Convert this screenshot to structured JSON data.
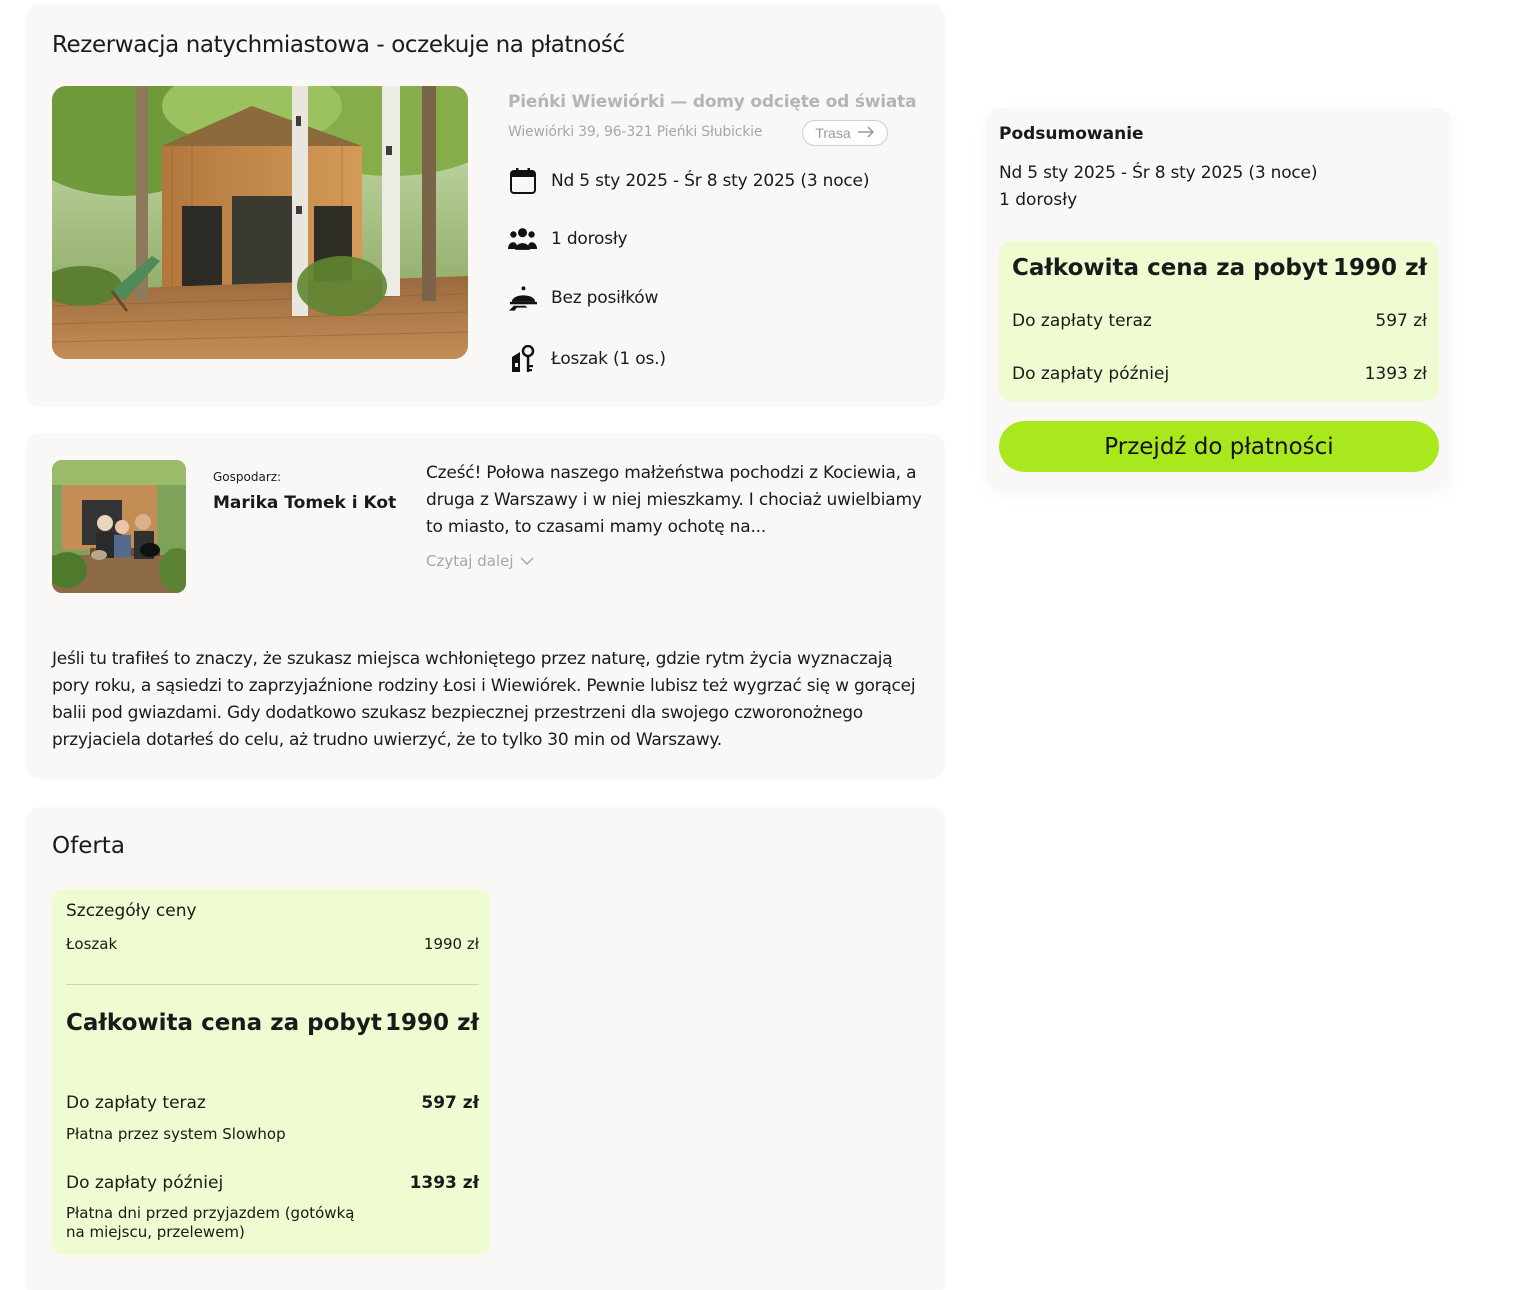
{
  "booking": {
    "title": "Rezerwacja natychmiastowa - oczekuje na płatność",
    "property_name": "Pieńki Wiewiórki — domy odcięte od świata",
    "address": "Wiewiórki 39, 96-321 Pieńki Słubickie",
    "route_label": "Trasa",
    "dates": "Nd 5 sty 2025 - Śr 8 sty 2025 (3 noce)",
    "guests": "1 dorosły",
    "meals": "Bez posiłków",
    "room": "Łoszak  (1 os.)"
  },
  "host": {
    "caption": "Gospodarz:",
    "name": "Marika Tomek i Kot",
    "bio": "Cześć! Połowa naszego małżeństwa pochodzi z Kociewia, a druga z Warszawy i w niej mieszkamy. I chociaż uwielbiamy to miasto, to czasami mamy ochotę na...",
    "read_more": "Czytaj dalej",
    "description": "Jeśli tu trafiłeś to znaczy, że szukasz miejsca wchłoniętego przez naturę, gdzie rytm życia wyznaczają pory roku, a sąsiedzi to zaprzyjaźnione rodziny Łosi i Wiewiórek. Pewnie lubisz też wygrzać się w gorącej balii pod gwiazdami. Gdy dodatkowo szukasz bezpiecznej przestrzeni dla swojego czworonożnego przyjaciela dotarłeś do celu, aż trudno uwierzyć, że to tylko 30 min od Warszawy."
  },
  "offer": {
    "title": "Oferta",
    "details_heading": "Szczegóły ceny",
    "item_name": "Łoszak",
    "item_price": "1990 zł",
    "total_label": "Całkowita cena za pobyt",
    "total_value": "1990 zł",
    "now_label": "Do zapłaty teraz",
    "now_value": "597 zł",
    "now_note": "Płatna przez system Slowhop",
    "later_label": "Do zapłaty później",
    "later_value": "1393 zł",
    "later_note": "Płatna dni przed przyjazdem (gotówką na miejscu, przelewem)"
  },
  "summary": {
    "title": "Podsumowanie",
    "dates": "Nd 5 sty 2025 - Śr 8 sty 2025 (3 noce)",
    "guests": "1 dorosły",
    "total_label": "Całkowita cena za pobyt",
    "total_value": "1990 zł",
    "now_label": "Do zapłaty teraz",
    "now_value": "597 zł",
    "later_label": "Do zapłaty później",
    "later_value": "1393 zł",
    "pay_button": "Przejdź do płatności"
  },
  "icons": {
    "calendar": "calendar-icon",
    "guests": "people-icon",
    "meals": "cloche-icon",
    "room": "key-icon",
    "route": "arrow-right-icon",
    "read_more": "chevron-down-icon"
  },
  "colors": {
    "accent": "#a9e81d",
    "price_panel": "#effbd0",
    "card_bg": "#f9f8f7"
  }
}
